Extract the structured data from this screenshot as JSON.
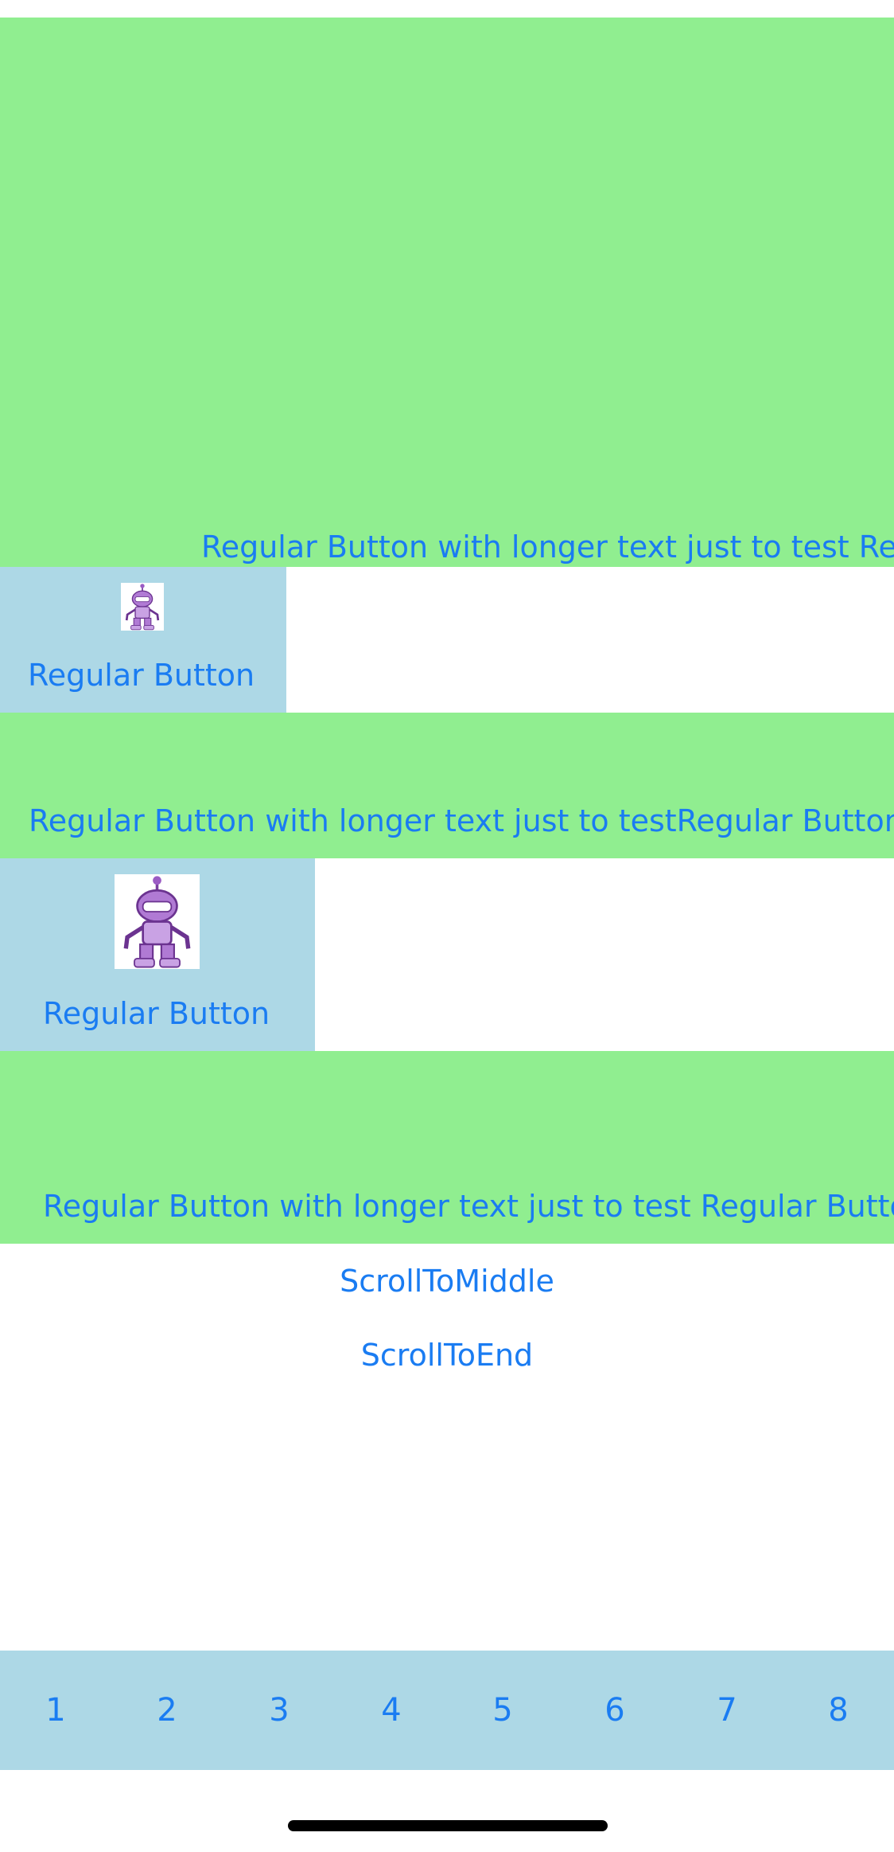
{
  "colors": {
    "green_panel": "#90ee90",
    "blue_panel": "#add8e6",
    "link": "#1a7cf2",
    "home_indicator": "#000000"
  },
  "rows": {
    "row1": {
      "label": "Regular Button with longer text just to test Re"
    },
    "row2": {
      "label": "Regular Button",
      "icon": "robot-icon"
    },
    "row3": {
      "label": "Regular Button with longer text just to testRegular Button"
    },
    "row4": {
      "label": "Regular Button",
      "icon": "robot-icon"
    },
    "row5": {
      "label": "Regular Button with longer text just to test Regular Butto"
    }
  },
  "actions": {
    "scroll_to_middle": "ScrollToMiddle",
    "scroll_to_end": "ScrollToEnd"
  },
  "tabs": [
    "1",
    "2",
    "3",
    "4",
    "5",
    "6",
    "7",
    "8"
  ]
}
